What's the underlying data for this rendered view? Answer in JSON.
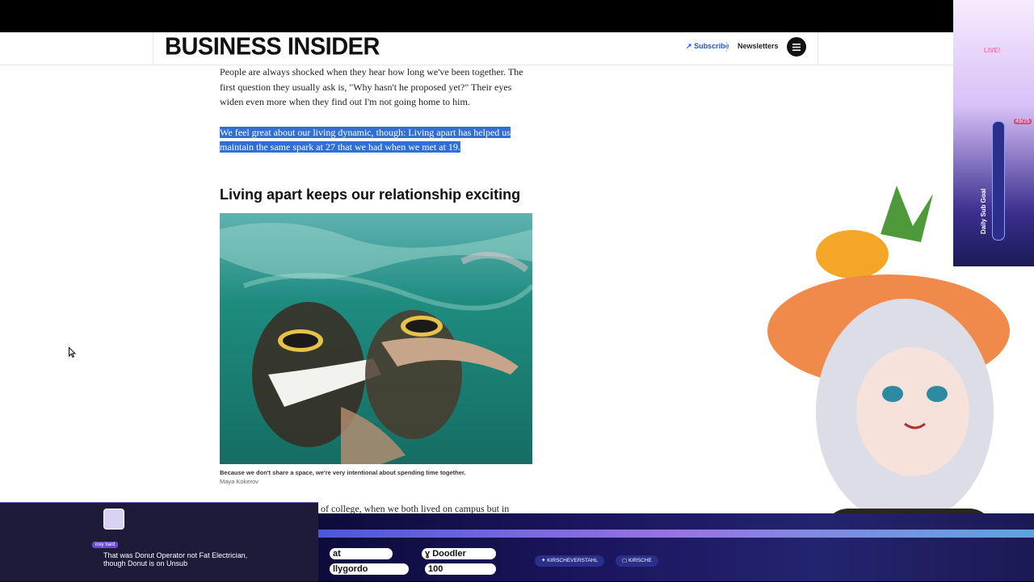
{
  "header": {
    "logo": "BUSINESS INSIDER",
    "subscribe": "Subscribe",
    "newsletters": "Newsletters",
    "menu_icon": "hamburger-menu-icon"
  },
  "article": {
    "para1": "People are always shocked when they hear how long we've been together. The first question they usually ask is, \"Why hasn't he proposed yet?\" Their eyes widen even more when they find out I'm not going home to him.",
    "para2": "We feel great about our living dynamic, though: Living apart has helped us maintain the same spark at 27 that we had when we met at 19.",
    "heading": "Living apart keeps our relationship exciting",
    "caption": "Because we don't share a space, we're very intentional about spending time together.",
    "credit": "Maya Kokerov",
    "cut_text": "of college, when we both lived on campus but in"
  },
  "stream": {
    "live_label": "LIVE!",
    "goal_label": "Daily Sub Goal",
    "goal_count": "49/25",
    "chat_user": "icey bard",
    "chat_message": "That was Donut Operator not Fat Electrician, though Donut is on Unsub",
    "stats": [
      {
        "label": "at"
      },
      {
        "label": "Doodler"
      },
      {
        "label": "llygordo"
      },
      {
        "label": "100"
      }
    ],
    "twitter": "KIRSCHEVERSTAHL",
    "twitch": "KIRSCHE"
  },
  "colors": {
    "highlight": "#2f6fd6",
    "subscribe_link": "#1a56db",
    "water": "#1f8c80"
  }
}
